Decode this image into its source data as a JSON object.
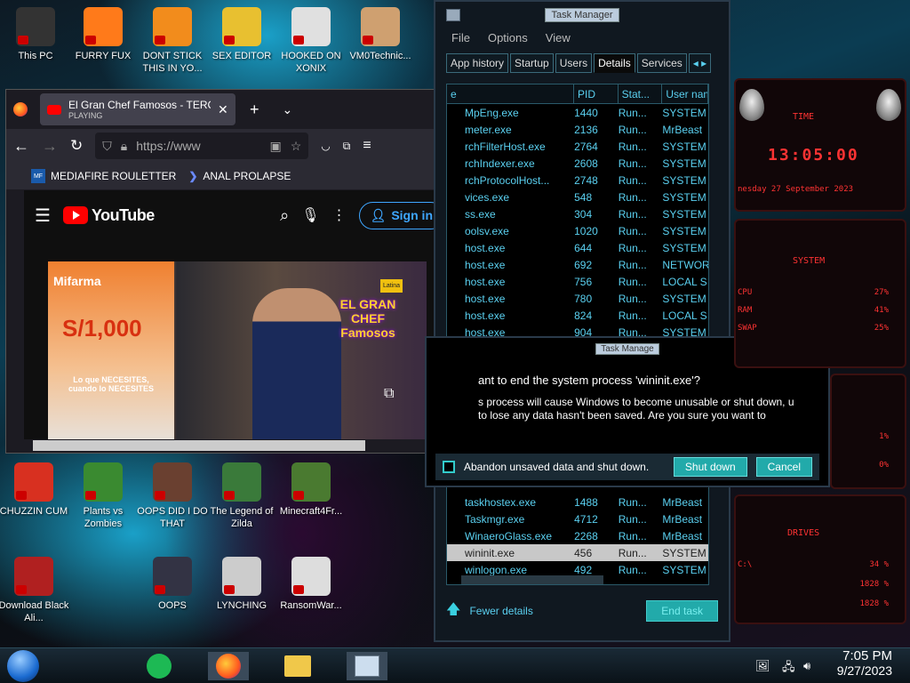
{
  "desktop": {
    "icons": [
      {
        "label": "This PC",
        "color": "#333"
      },
      {
        "label": "FURRY FUX",
        "color": "#ff7a1a"
      },
      {
        "label": "DONT STICK THIS IN YO...",
        "color": "#f28c1c"
      },
      {
        "label": "SEX EDITOR",
        "color": "#e8c030"
      },
      {
        "label": "HOOKED ON XONIX",
        "color": "#e0e0e0"
      },
      {
        "label": "VM0Technic...",
        "color": "#cfa070"
      },
      {
        "label": "CHUZZIN CUM",
        "color": "#d83020"
      },
      {
        "label": "Plants vs Zombies",
        "color": "#3a8a30"
      },
      {
        "label": "OOPS DID I DO THAT",
        "color": "#6a4030"
      },
      {
        "label": "The Legend of Zilda",
        "color": "#3a7a3a"
      },
      {
        "label": "Minecraft4Fr...",
        "color": "#4a7a30"
      },
      {
        "label": "Download Black Ali...",
        "color": "#b02020"
      },
      {
        "label": "OOPS",
        "color": "#334"
      },
      {
        "label": "LYNCHING",
        "color": "#ccc"
      },
      {
        "label": "RansomWar...",
        "color": "#ddd"
      }
    ]
  },
  "browser": {
    "tab_title": "El Gran Chef Famosos - TERCER",
    "tab_sub": "PLAYING",
    "url": "https://www",
    "bookmarks": [
      "MEDIAFIRE ROULETTER",
      "ANAL PROLAPSE"
    ],
    "youtube": {
      "logo": "YouTube",
      "signin": "Sign in"
    },
    "video": {
      "promo_brand": "Mifarma",
      "promo_price": "S/1,000",
      "promo_text": "Lo que NECESITES, cuando lo NECESITES",
      "show_logo": "EL GRAN CHEF Famosos",
      "channel": "Latina"
    }
  },
  "taskmgr": {
    "title": "Task Manager",
    "menu": [
      "File",
      "Options",
      "View"
    ],
    "tabs": [
      "App history",
      "Startup",
      "Users",
      "Details",
      "Services"
    ],
    "active_tab": "Details",
    "columns": [
      "e",
      "PID",
      "Stat...",
      "User nam"
    ],
    "rows": [
      {
        "name": "MpEng.exe",
        "pid": "1440",
        "status": "Run...",
        "user": "SYSTEM"
      },
      {
        "name": "meter.exe",
        "pid": "2136",
        "status": "Run...",
        "user": "MrBeast"
      },
      {
        "name": "rchFilterHost.exe",
        "pid": "2764",
        "status": "Run...",
        "user": "SYSTEM"
      },
      {
        "name": "rchIndexer.exe",
        "pid": "2608",
        "status": "Run...",
        "user": "SYSTEM"
      },
      {
        "name": "rchProtocolHost...",
        "pid": "2748",
        "status": "Run...",
        "user": "SYSTEM"
      },
      {
        "name": "vices.exe",
        "pid": "548",
        "status": "Run...",
        "user": "SYSTEM"
      },
      {
        "name": "ss.exe",
        "pid": "304",
        "status": "Run...",
        "user": "SYSTEM"
      },
      {
        "name": "oolsv.exe",
        "pid": "1020",
        "status": "Run...",
        "user": "SYSTEM"
      },
      {
        "name": "host.exe",
        "pid": "644",
        "status": "Run...",
        "user": "SYSTEM"
      },
      {
        "name": "host.exe",
        "pid": "692",
        "status": "Run...",
        "user": "NETWOR"
      },
      {
        "name": "host.exe",
        "pid": "756",
        "status": "Run...",
        "user": "LOCAL S"
      },
      {
        "name": "host.exe",
        "pid": "780",
        "status": "Run...",
        "user": "SYSTEM"
      },
      {
        "name": "host.exe",
        "pid": "824",
        "status": "Run...",
        "user": "LOCAL S"
      },
      {
        "name": "host.exe",
        "pid": "904",
        "status": "Run...",
        "user": "SYSTEM"
      }
    ],
    "rows_bottom": [
      {
        "name": "taskhostex.exe",
        "pid": "1488",
        "status": "Run...",
        "user": "MrBeast",
        "sel": false
      },
      {
        "name": "Taskmgr.exe",
        "pid": "4712",
        "status": "Run...",
        "user": "MrBeast",
        "sel": false
      },
      {
        "name": "WinaeroGlass.exe",
        "pid": "2268",
        "status": "Run...",
        "user": "MrBeast",
        "sel": false
      },
      {
        "name": "wininit.exe",
        "pid": "456",
        "status": "Run...",
        "user": "SYSTEM",
        "sel": true
      },
      {
        "name": "winlogon.exe",
        "pid": "492",
        "status": "Run...",
        "user": "SYSTEM",
        "sel": false
      }
    ],
    "fewer_details": "Fewer details",
    "end_task": "End task"
  },
  "dialog": {
    "title": "Task Manage",
    "question": "ant to end the system process 'wininit.exe'?",
    "detail": "s process will cause Windows to become unusable or shut down, u to lose any data hasn't been saved. Are you sure you want to",
    "checkbox_label": "Abandon unsaved data and shut down.",
    "shutdown": "Shut down",
    "cancel": "Cancel"
  },
  "widgets": {
    "time_label": "TIME",
    "time": "13:05:00",
    "date": "nesday 27 September 2023",
    "system_label": "SYSTEM",
    "cpu_label": "CPU",
    "cpu": "27%",
    "ram_label": "RAM",
    "ram": "41%",
    "swap_label": "SWAP",
    "swap": "25%",
    "mid1": "1%",
    "mid2": "0%",
    "drives_label": "DRIVES",
    "d1_label": "C:\\",
    "d1": "34 %",
    "d2": "1828 %",
    "d3": "1828 %"
  },
  "taskbar": {
    "time": "7:05 PM",
    "date": "9/27/2023"
  },
  "colors": {
    "accent": "#22aaaa",
    "tm_text": "#5ad0f0",
    "widget_red": "#ff3333"
  }
}
